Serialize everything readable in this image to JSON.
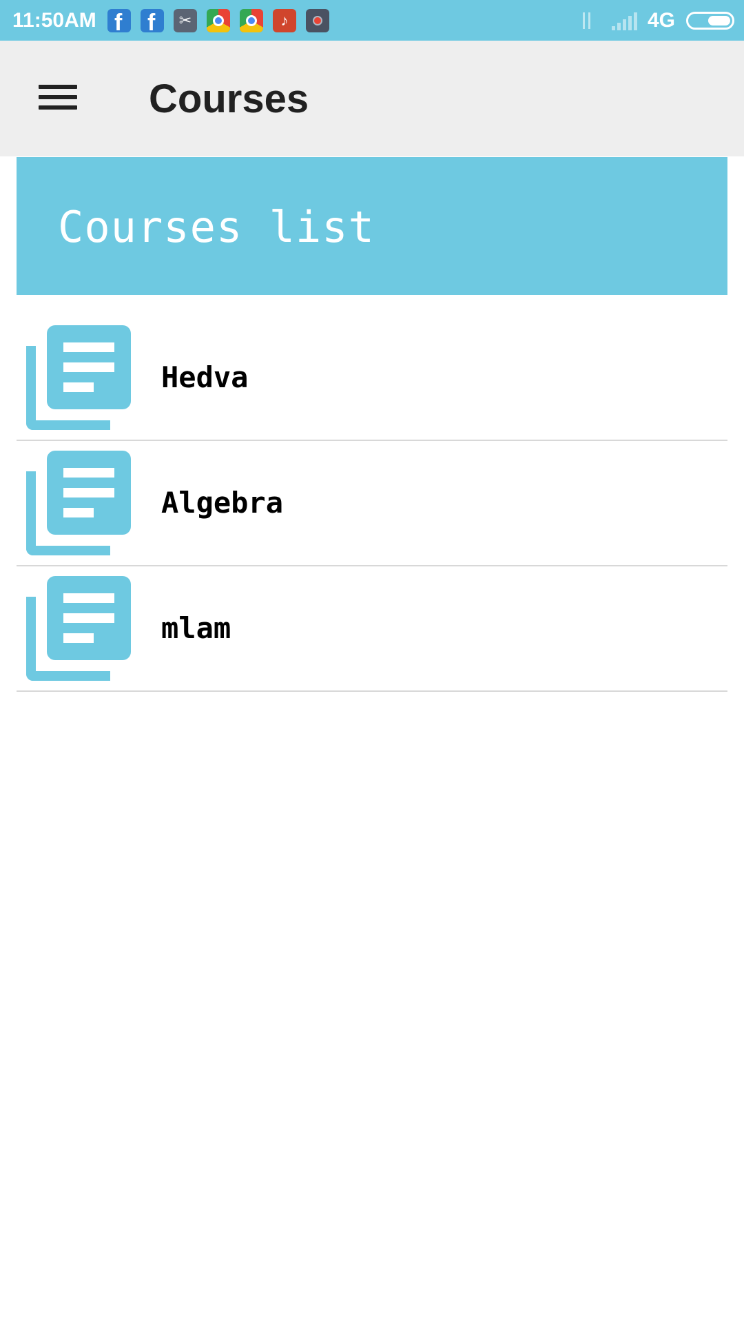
{
  "status_bar": {
    "time": "11:50AM",
    "network_type": "4G",
    "battery_level": 0.55,
    "notification_icons": [
      "facebook-icon",
      "facebook-icon",
      "scissors-icon",
      "chrome-icon",
      "chrome-icon",
      "music-icon",
      "screen-record-icon"
    ],
    "colors": {
      "background": "#6ec9e1"
    }
  },
  "toolbar": {
    "menu_icon": "hamburger-menu-icon",
    "title": "Courses"
  },
  "banner": {
    "title": "Courses list",
    "colors": {
      "background": "#6ec9e1",
      "text": "#ffffff"
    }
  },
  "courses": [
    {
      "name": "Hedva",
      "icon": "course-book-icon"
    },
    {
      "name": "Algebra",
      "icon": "course-book-icon"
    },
    {
      "name": "mlam",
      "icon": "course-book-icon"
    }
  ],
  "colors": {
    "accent": "#6ec9e1",
    "toolbar_bg": "#eeeeee",
    "divider": "#d8d8d8"
  }
}
